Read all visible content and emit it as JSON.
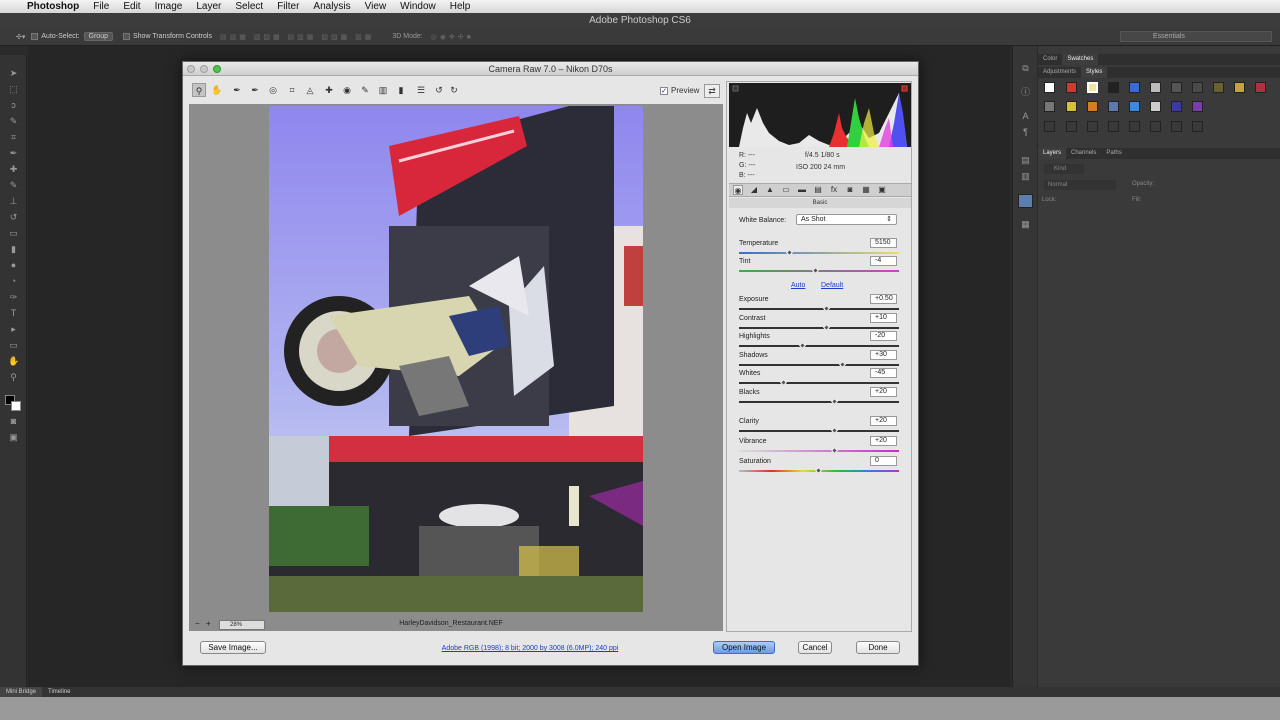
{
  "menubar": {
    "app": "Photoshop",
    "items": [
      "File",
      "Edit",
      "Image",
      "Layer",
      "Select",
      "Filter",
      "Analysis",
      "View",
      "Window",
      "Help"
    ]
  },
  "app_title": "Adobe Photoshop CS6",
  "options_bar": {
    "auto_select_label": "Auto-Select:",
    "auto_select_value": "Group",
    "transform_label": "Show Transform Controls",
    "mode_3d": "3D Mode:",
    "workspace": "Essentials"
  },
  "panels": {
    "top_tabs": [
      "Color",
      "Swatches"
    ],
    "active_top_tab": "Swatches",
    "second_tabs": [
      "Adjustments",
      "Styles"
    ],
    "layers_tabs": [
      "Layers",
      "Channels",
      "Paths"
    ],
    "kind": "Kind",
    "blend": "Normal",
    "opacity_label": "Opacity:",
    "lock_label": "Lock:",
    "fill_label": "Fill:"
  },
  "bottom_tabs": [
    "Mini Bridge",
    "Timeline"
  ],
  "dialog": {
    "title": "Camera Raw 7.0  –  Nikon D70s",
    "preview_label": "Preview",
    "preview_checked": true,
    "zoom": "28%",
    "filename": "HarleyDavidson_Restaurant.NEF",
    "info": {
      "r": "R:  ---",
      "g": "G:  ---",
      "b": "B:  ---",
      "aperture_shutter": "f/4.5   1/80 s",
      "iso_focal": "ISO 200    24 mm"
    },
    "panel_name": "Basic",
    "white_balance_label": "White Balance:",
    "white_balance_value": "As Shot",
    "auto_link": "Auto",
    "default_link": "Default",
    "sliders": [
      {
        "label": "Temperature",
        "value": "5150",
        "pos": 0.32
      },
      {
        "label": "Tint",
        "value": "-4",
        "pos": 0.48
      },
      {
        "label": "Exposure",
        "value": "+0.50",
        "pos": 0.55
      },
      {
        "label": "Contrast",
        "value": "+10",
        "pos": 0.55
      },
      {
        "label": "Highlights",
        "value": "-20",
        "pos": 0.4
      },
      {
        "label": "Shadows",
        "value": "+30",
        "pos": 0.65
      },
      {
        "label": "Whites",
        "value": "-45",
        "pos": 0.28
      },
      {
        "label": "Blacks",
        "value": "+20",
        "pos": 0.6
      },
      {
        "label": "Clarity",
        "value": "+20",
        "pos": 0.6
      },
      {
        "label": "Vibrance",
        "value": "+20",
        "pos": 0.6
      },
      {
        "label": "Saturation",
        "value": "0",
        "pos": 0.5
      }
    ],
    "save_button": "Save Image...",
    "workflow_info": "Adobe RGB (1998); 8 bit; 2000 by 3008 (6.0MP); 240 ppi",
    "open_button": "Open Image",
    "cancel_button": "Cancel",
    "done_button": "Done"
  }
}
